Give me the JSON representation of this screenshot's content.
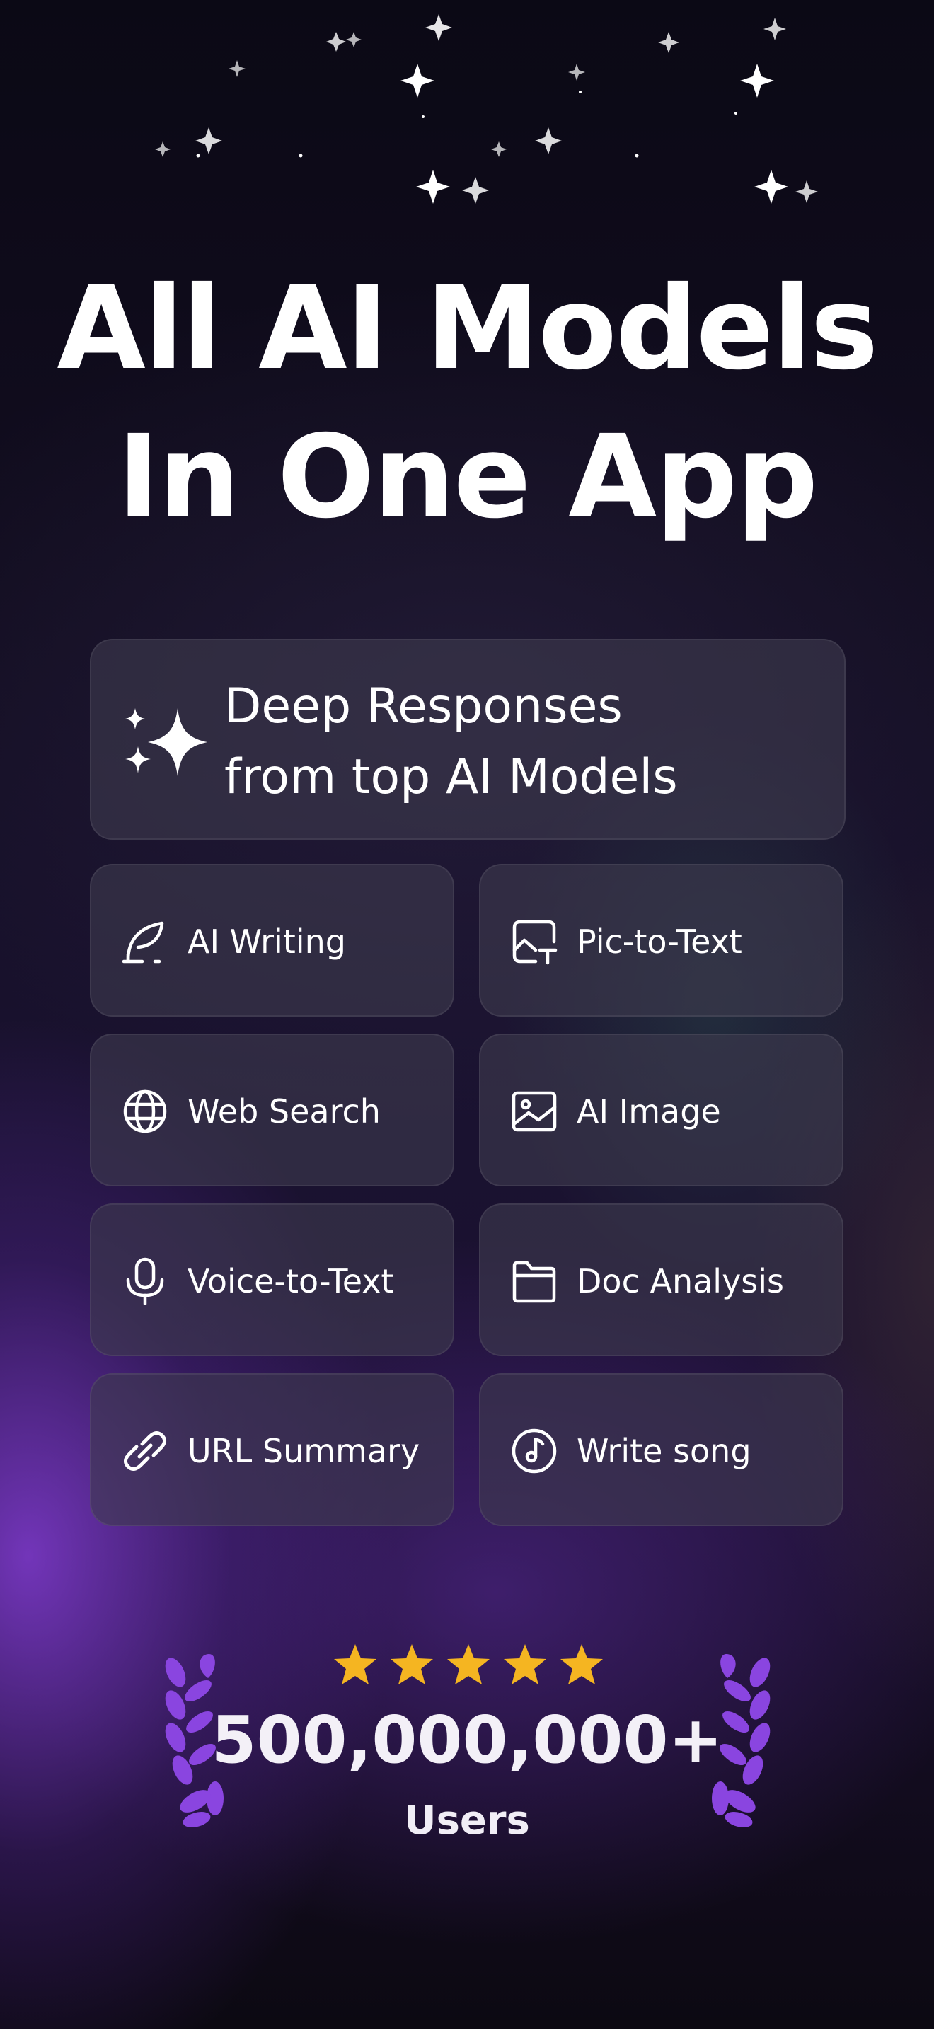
{
  "headline": {
    "line1": "All AI Models",
    "line2": "In One App"
  },
  "hero_card": {
    "icon": "sparkle-icon",
    "line1": "Deep Responses",
    "line2": "from top AI Models"
  },
  "features": [
    {
      "label": "AI Writing",
      "icon": "quill-icon"
    },
    {
      "label": "Pic-to-Text",
      "icon": "image-to-text-icon"
    },
    {
      "label": "Web Search",
      "icon": "globe-icon"
    },
    {
      "label": "AI Image",
      "icon": "image-icon"
    },
    {
      "label": "Voice-to-Text",
      "icon": "microphone-icon"
    },
    {
      "label": "Doc Analysis",
      "icon": "folder-icon"
    },
    {
      "label": "URL Summary",
      "icon": "link-icon"
    },
    {
      "label": "Write song",
      "icon": "music-note-icon"
    }
  ],
  "rating": {
    "stars": 5,
    "max_stars": 5,
    "star_color": "#f5b521"
  },
  "stats": {
    "count": "500,000,000+",
    "unit": "Users"
  },
  "colors": {
    "accent_purple": "#8a45e0",
    "card_bg": "#3e3a4e"
  }
}
